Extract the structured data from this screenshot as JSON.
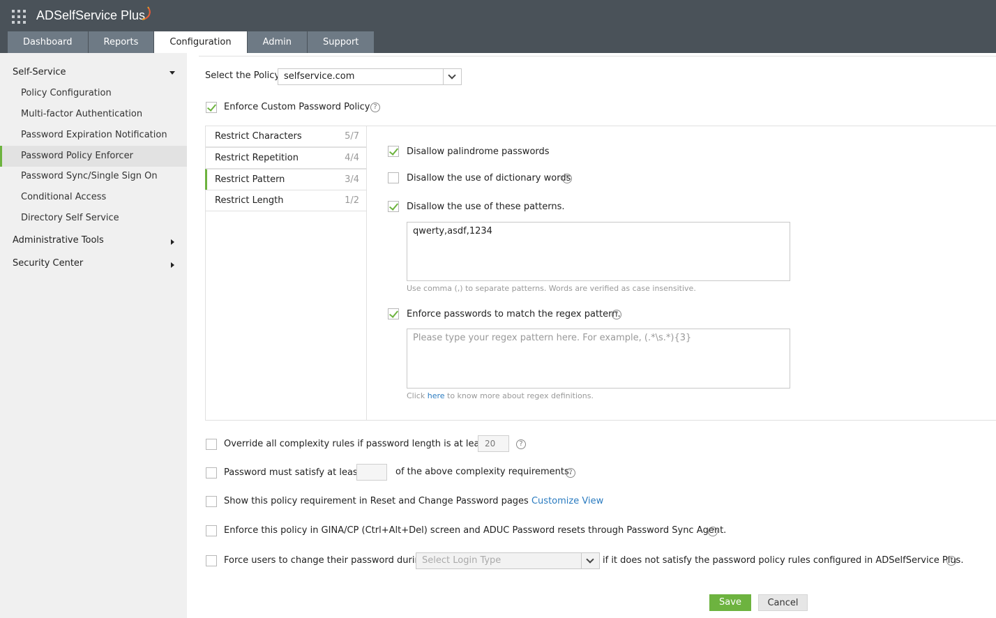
{
  "header": {
    "brand": "ADSelfService Plus",
    "tabs": [
      "Dashboard",
      "Reports",
      "Configuration",
      "Admin",
      "Support"
    ]
  },
  "sidebar": {
    "self_service": "Self-Service",
    "items": [
      "Policy Configuration",
      "Multi-factor Authentication",
      "Password Expiration Notification",
      "Password Policy Enforcer",
      "Password Sync/Single Sign On",
      "Conditional Access",
      "Directory Self Service"
    ],
    "administrative_tools": "Administrative Tools",
    "security_center": "Security Center"
  },
  "policy": {
    "label": "Select the Policy",
    "value": "selfservice.com"
  },
  "enforce_custom": {
    "label": "Enforce Custom Password Policy",
    "checked": true
  },
  "rule_tabs": [
    {
      "label": "Restrict Characters",
      "count": "5/7"
    },
    {
      "label": "Restrict Repetition",
      "count": "4/4"
    },
    {
      "label": "Restrict Pattern",
      "count": "3/4"
    },
    {
      "label": "Restrict Length",
      "count": "1/2"
    }
  ],
  "pattern": {
    "palindrome": "Disallow palindrome passwords",
    "dictionary": "Disallow the use of dictionary words",
    "patterns": "Disallow the use of these patterns.",
    "patterns_value": "qwerty,asdf,1234",
    "patterns_hint": "Use comma (,) to separate patterns. Words are verified as case insensitive.",
    "regex": "Enforce passwords to match the regex pattern.",
    "regex_placeholder": "Please type your regex pattern here. For example, (.*\\s.*){3}",
    "regex_hint_pre": "Click ",
    "regex_hint_link": "here",
    "regex_hint_post": " to know more about regex definitions."
  },
  "options": {
    "override_label": "Override all complexity rules if password length is at least",
    "override_value": "20",
    "satisfy_pre": "Password must satisfy at least",
    "satisfy_value": "",
    "satisfy_post": "of the above complexity requirements.",
    "show_req": "Show this policy requirement in Reset and Change Password pages",
    "customize_view": "Customize View",
    "gina": "Enforce this policy in GINA/CP (Ctrl+Alt+Del) screen and ADUC Password resets through Password Sync Agent.",
    "force_pre": "Force users to change their password during",
    "login_type_placeholder": "Select Login Type",
    "force_post": "if it does not satisfy the password policy rules configured in ADSelfService Plus."
  },
  "buttons": {
    "save": "Save",
    "cancel": "Cancel"
  },
  "colors": {
    "header_bg": "#4a5259",
    "tab_bg": "#6e7a85",
    "accent_green": "#6db33f",
    "link_blue": "#2a7bc0",
    "sidebar_bg": "#f0f0f0"
  }
}
